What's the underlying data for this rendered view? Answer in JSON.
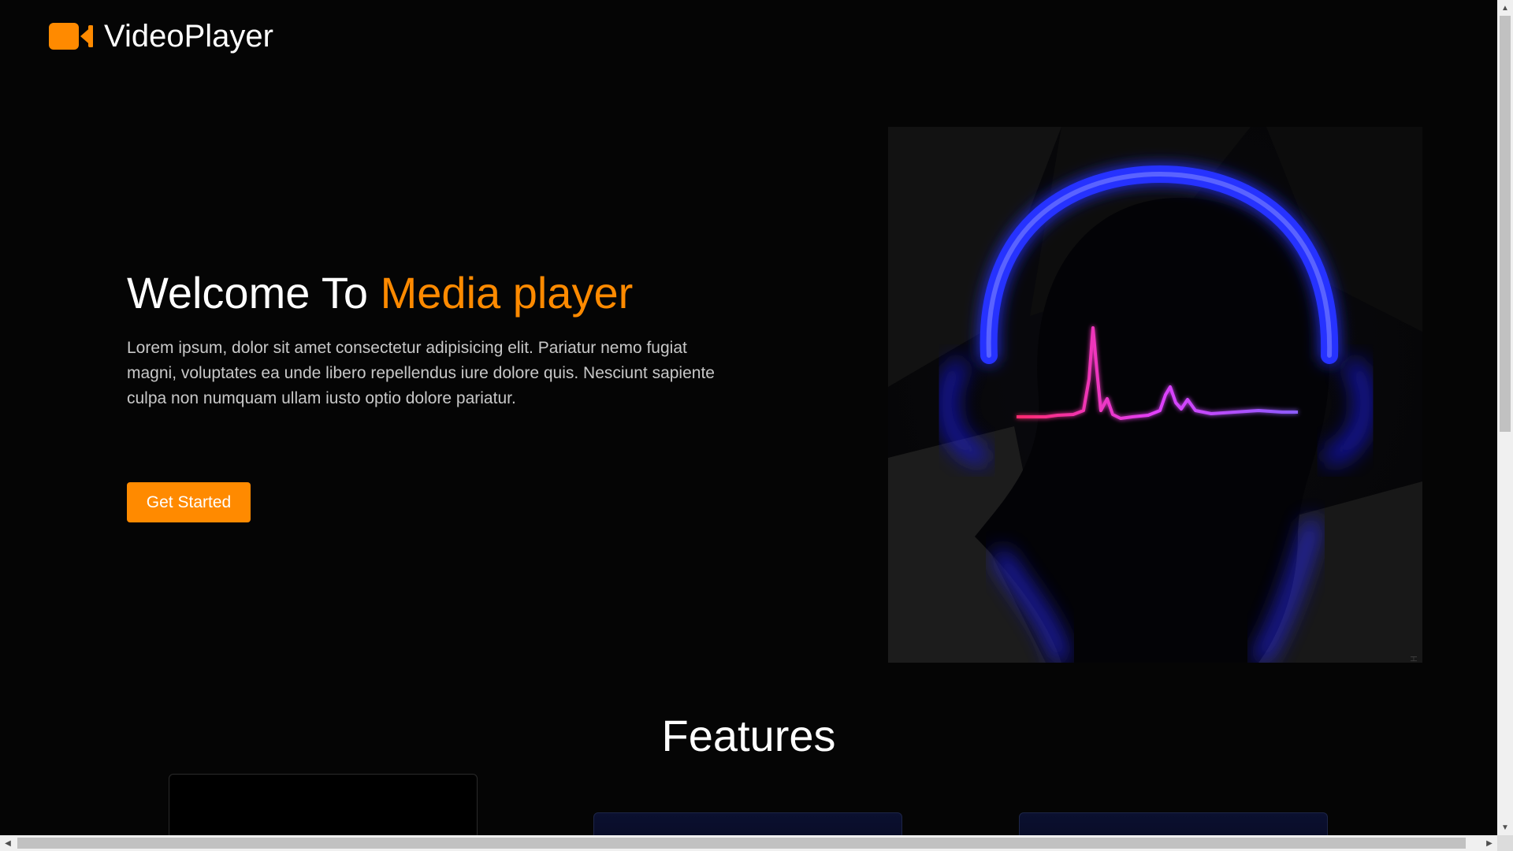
{
  "app": {
    "logo_text": "VideoPlayer",
    "logo_icon": "video-camera-icon",
    "brand_color": "#ff8a00",
    "background_color": "#050505"
  },
  "hero": {
    "title_prefix": "Welcome To ",
    "title_accent": "Media player",
    "description": "Lorem ipsum, dolor sit amet consectetur adipisicing elit. Pariatur nemo fugiat magni, voluptates ea unde libero repellendus iure dolore quis. Nesciunt sapiente culpa non numquam ullam iusto optio dolore pariatur.",
    "cta_label": "Get Started",
    "image_signature": "KIDMOGRAPH"
  },
  "features": {
    "title": "Features"
  },
  "scrollbars": {
    "up_icon": "▲",
    "down_icon": "▼",
    "left_icon": "◀",
    "right_icon": "▶"
  }
}
